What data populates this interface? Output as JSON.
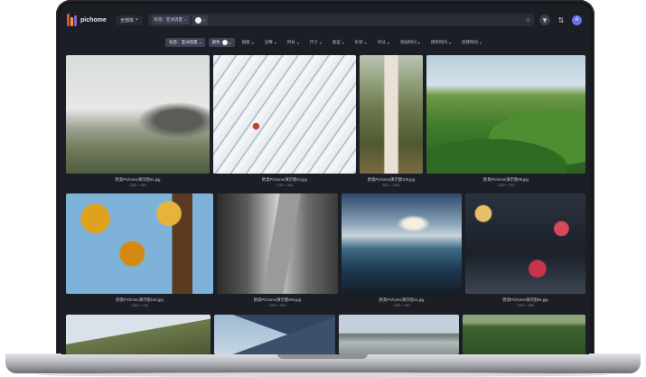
{
  "app": {
    "name": "pichome",
    "logo_colors": [
      "#d9532c",
      "#e7a43a",
      "#8a61c9"
    ]
  },
  "topbar": {
    "scope_label": "全部库",
    "search_chip_label": "标签：亚洲消夏",
    "search_chip_remove": "×",
    "color_chip_remove": "×",
    "clear_icon": "⊗",
    "filter_icon": "▼",
    "sort_icon": "⇅",
    "avatar_letter": "A"
  },
  "filters": [
    {
      "label": "标签：亚洲消夏",
      "active": true,
      "has_caret": true
    },
    {
      "label": "颜色",
      "active": true,
      "has_dot": true,
      "has_caret": true
    },
    {
      "label": "链接",
      "has_caret": true
    },
    {
      "label": "注释",
      "has_caret": true
    },
    {
      "label": "时长",
      "has_caret": true
    },
    {
      "label": "尺寸",
      "has_caret": true
    },
    {
      "label": "类型",
      "has_caret": true
    },
    {
      "label": "形状",
      "has_caret": true
    },
    {
      "label": "评分",
      "has_caret": true
    },
    {
      "label": "添加时间",
      "has_caret": true
    },
    {
      "label": "修改时间",
      "has_caret": true
    },
    {
      "label": "创建时间",
      "has_caret": true
    }
  ],
  "gallery": {
    "items": [
      {
        "name": "欧奥Pichome演示图01.jpg",
        "size": "1280 × 851"
      },
      {
        "name": "欧奥Pichome演示图04.jpg",
        "size": "1280 × 854"
      },
      {
        "name": "欧奥Pichome演示图105.jpg",
        "size": "852 × 1280"
      },
      {
        "name": "欧奥Pichome演示图99.jpg",
        "size": "1280 × 763"
      },
      {
        "name": "欧奥Pichome演示图160.jpg",
        "size": "1280 × 755"
      },
      {
        "name": "欧奥Pichome演示图469.jpg",
        "size": "1280 × 852"
      },
      {
        "name": "欧奥Pichome演示图41.jpg",
        "size": "1280 × 851"
      },
      {
        "name": "欧奥Pichome演示图66.jpg",
        "size": "1280 × 855"
      }
    ]
  }
}
